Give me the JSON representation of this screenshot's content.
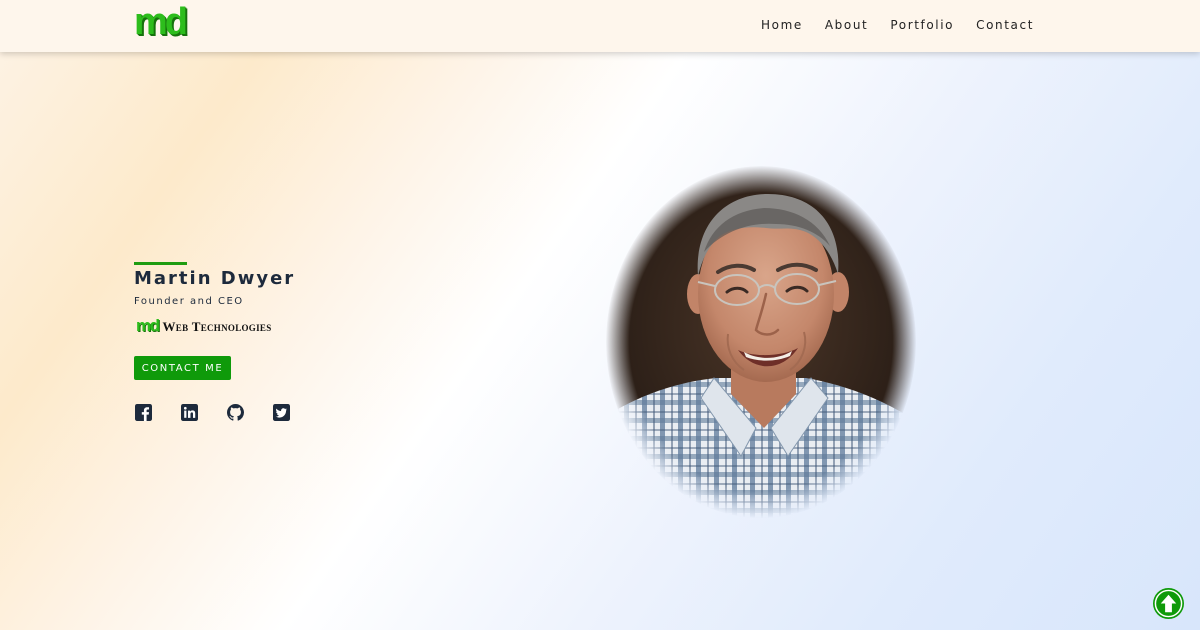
{
  "header": {
    "logo_text": "md",
    "nav": [
      {
        "label": "Home"
      },
      {
        "label": "About"
      },
      {
        "label": "Portfolio"
      },
      {
        "label": "Contact"
      }
    ]
  },
  "hero": {
    "name": "Martin Dwyer",
    "role": "Founder and CEO",
    "company_mark": "md",
    "company_name": "Web Technologies",
    "contact_button": "CONTACT ME",
    "socials": [
      {
        "icon": "facebook-icon"
      },
      {
        "icon": "linkedin-icon"
      },
      {
        "icon": "github-icon"
      },
      {
        "icon": "twitter-icon"
      }
    ]
  },
  "colors": {
    "brand_green": "#2dbd1c",
    "button_green": "#0f9a0a",
    "text_dark": "#1d2a3c",
    "header_bg": "#fef6ec"
  }
}
